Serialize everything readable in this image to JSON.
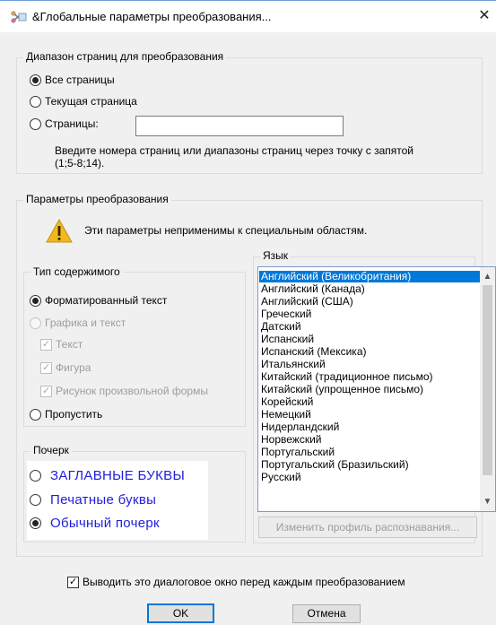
{
  "window": {
    "title": "&Глобальные параметры преобразования...",
    "close": "✕",
    "icon": "ocr-scissors-icon"
  },
  "page_range": {
    "label": "Диапазон страниц для преобразования",
    "options": [
      {
        "label": "Все страницы",
        "checked": true
      },
      {
        "label": "Текущая страница",
        "checked": false
      },
      {
        "label": "Страницы:",
        "checked": false
      }
    ],
    "pages_value": "",
    "hint_line1": "Введите номера страниц или диапазоны страниц через точку с запятой",
    "hint_line2": "(1;5-8;14)."
  },
  "conversion": {
    "label": "Параметры преобразования",
    "warning_text": "Эти параметры неприменимы к специальным областям.",
    "warning_icon": "warning-triangle-icon"
  },
  "content_type": {
    "label": "Тип содержимого",
    "formatted_text": "Форматированный текст",
    "graphics_text": "Графика и текст",
    "text": "Текст",
    "shape": "Фигура",
    "freeform": "Рисунок произвольной формы",
    "skip": "Пропустить"
  },
  "handwriting": {
    "label": "Почерк",
    "caps": "ЗАГЛАВНЫЕ БУКВЫ",
    "print": "Печатные буквы",
    "cursive": "Обычный почерк",
    "color": "#1e1edc"
  },
  "language": {
    "label": "Язык",
    "items": [
      "Английский (Великобритания)",
      "Английский (Канада)",
      "Английский (США)",
      "Греческий",
      "Датский",
      "Испанский",
      "Испанский (Мексика)",
      "Итальянский",
      "Китайский (традиционное письмо)",
      "Китайский (упрощенное письмо)",
      "Корейский",
      "Немецкий",
      "Нидерландский",
      "Норвежский",
      "Португальский",
      "Португальский (Бразильский)",
      "Русский"
    ],
    "selected_index": 0,
    "profile_button": "Изменить профиль распознавания..."
  },
  "footer": {
    "show_dialog_label": "Выводить это диалоговое окно перед каждым преобразованием",
    "show_dialog_checked": true,
    "ok": "OK",
    "cancel": "Отмена"
  },
  "colors": {
    "accent": "#0078d7",
    "selection": "#0078d7",
    "warning": "#f0b400"
  }
}
